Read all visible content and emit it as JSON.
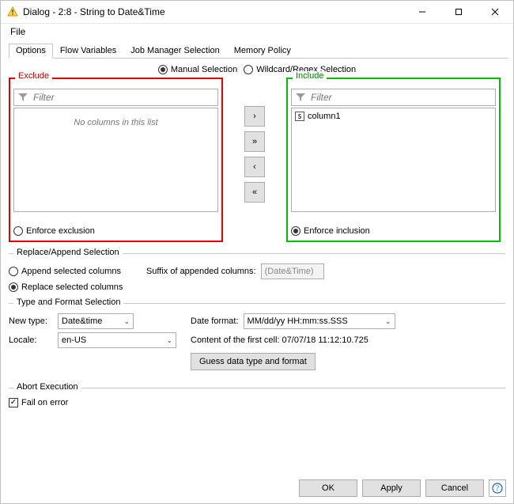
{
  "window": {
    "title": "Dialog - 2:8 - String to Date&Time",
    "minimize": "–",
    "maximize": "☐",
    "close": "✕"
  },
  "menu": {
    "file": "File"
  },
  "tabs": [
    "Options",
    "Flow Variables",
    "Job Manager Selection",
    "Memory Policy"
  ],
  "selection_mode": {
    "manual": "Manual Selection",
    "regex": "Wildcard/Regex Selection"
  },
  "exclude": {
    "legend": "Exclude",
    "filter_placeholder": "Filter",
    "empty": "No columns in this list",
    "enforce": "Enforce exclusion"
  },
  "include": {
    "legend": "Include",
    "filter_placeholder": "Filter",
    "columns": [
      {
        "type": "S",
        "name": "column1"
      }
    ],
    "enforce": "Enforce inclusion"
  },
  "move": {
    "right": "›",
    "all_right": "»",
    "left": "‹",
    "all_left": "«"
  },
  "replace": {
    "legend": "Replace/Append Selection",
    "append": "Append selected columns",
    "replace_label": "Replace selected columns",
    "suffix_label": "Suffix of appended columns:",
    "suffix_value": "(Date&Time)"
  },
  "typefmt": {
    "legend": "Type and Format Selection",
    "new_type_label": "New type:",
    "new_type_value": "Date&time",
    "locale_label": "Locale:",
    "locale_value": "en-US",
    "date_format_label": "Date format:",
    "date_format_value": "MM/dd/yy HH:mm:ss.SSS",
    "content_label": "Content of the first cell: 07/07/18 11:12:10.725",
    "guess_btn": "Guess data type and format"
  },
  "abort": {
    "legend": "Abort Execution",
    "fail": "Fail on error"
  },
  "buttons": {
    "ok": "OK",
    "apply": "Apply",
    "cancel": "Cancel",
    "help": "?"
  }
}
